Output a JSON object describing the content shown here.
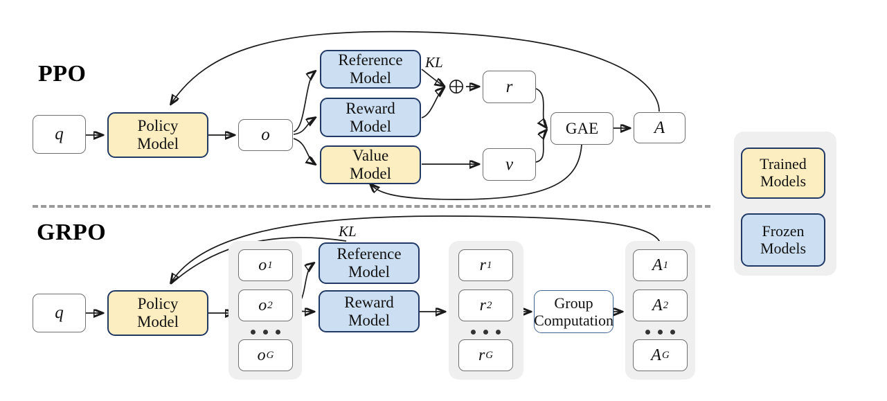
{
  "figure": {
    "type": "diagram",
    "description": "Comparison of PPO and GRPO reinforcement learning pipelines",
    "divider": "dashed-horizontal-separator"
  },
  "ppo": {
    "title": "PPO",
    "nodes": {
      "query": "q",
      "policy_model": "Policy\nModel",
      "policy_model_line1": "Policy",
      "policy_model_line2": "Model",
      "output": "o",
      "reference_model_line1": "Reference",
      "reference_model_line2": "Model",
      "reward_model_line1": "Reward",
      "reward_model_line2": "Model",
      "value_model_line1": "Value",
      "value_model_line2": "Model",
      "reward": "r",
      "value": "v",
      "gae": "GAE",
      "advantage": "A"
    },
    "labels": {
      "kl": "KL",
      "plus_operator": "⊕"
    }
  },
  "grpo": {
    "title": "GRPO",
    "nodes": {
      "query": "q",
      "policy_model_line1": "Policy",
      "policy_model_line2": "Model",
      "reference_model_line1": "Reference",
      "reference_model_line2": "Model",
      "reward_model_line1": "Reward",
      "reward_model_line2": "Model",
      "group_computation_line1": "Group",
      "group_computation_line2": "Computation"
    },
    "labels": {
      "kl": "KL"
    },
    "outputs": {
      "base": "o",
      "items": [
        {
          "base": "o",
          "sub": "1"
        },
        {
          "base": "o",
          "sub": "2"
        },
        {
          "base": "o",
          "sub": "G"
        }
      ],
      "ellipsis": "..."
    },
    "rewards": {
      "base": "r",
      "items": [
        {
          "base": "r",
          "sub": "1"
        },
        {
          "base": "r",
          "sub": "2"
        },
        {
          "base": "r",
          "sub": "G"
        }
      ],
      "ellipsis": "..."
    },
    "advantages": {
      "base": "A",
      "items": [
        {
          "base": "A",
          "sub": "1"
        },
        {
          "base": "A",
          "sub": "2"
        },
        {
          "base": "A",
          "sub": "G"
        }
      ],
      "ellipsis": "..."
    }
  },
  "legend": {
    "items": [
      {
        "label_line1": "Trained",
        "label_line2": "Models",
        "style": "trained"
      },
      {
        "label_line1": "Frozen",
        "label_line2": "Models",
        "style": "frozen"
      }
    ]
  },
  "colors": {
    "trained_fill": "#fdeec2",
    "frozen_fill": "#ccdff2",
    "model_border": "#1f3864",
    "group_container": "#efefef",
    "plain_border": "#6f6f6f",
    "divider": "#9a9a9a",
    "wire": "#1a1a1a"
  }
}
